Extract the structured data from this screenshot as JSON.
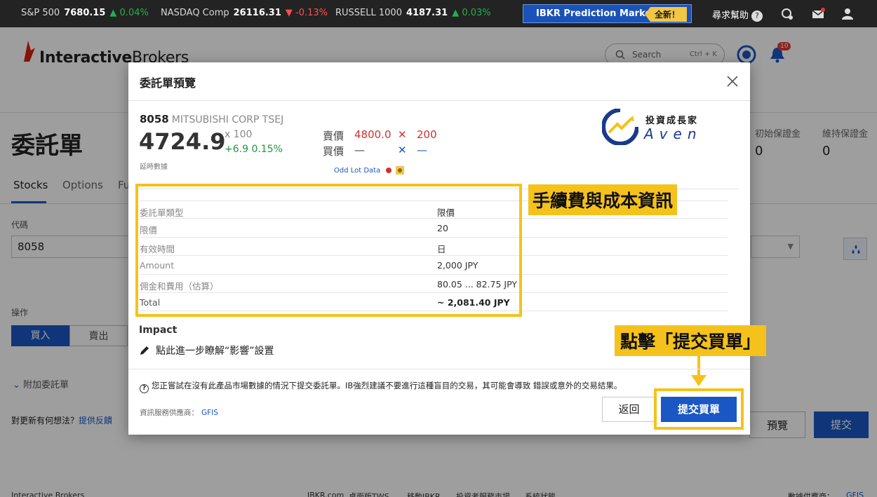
{
  "ticker": [
    {
      "name": "S&P 500",
      "price": "7680.15",
      "change": "▲ 0.04%",
      "dir": "up"
    },
    {
      "name": "NASDAQ Comp",
      "price": "26116.31",
      "change": "▼ -0.13%",
      "dir": "down"
    },
    {
      "name": "RUSSELL 1000",
      "price": "4187.31",
      "change": "▲ 0.03%",
      "dir": "up"
    }
  ],
  "promo": {
    "label": "IBKR Prediction Markets",
    "badge": "全新！"
  },
  "help": {
    "label": "尋求幫助",
    "q": "?"
  },
  "header": {
    "logo_bold": "Interactive",
    "logo_thin": "Brokers",
    "search_placeholder": "Search",
    "search_shortcut": "Ctrl + K",
    "notifications": "10"
  },
  "page": {
    "title": "委託單",
    "tabs": [
      "Stocks",
      "Options",
      "Fu"
    ],
    "symbol_label": "代碼",
    "symbol_value": "8058",
    "action_label": "操作",
    "buy": "買入",
    "sell": "賣出",
    "attach_order": "附加委託單",
    "feedback_q": "對更新有何想法？",
    "feedback_link": "提供反饋",
    "initial_margin_label": "初始保證金",
    "initial_margin_value": "0",
    "maint_margin_label": "維持保證金",
    "maint_margin_value": "0",
    "preview_btn": "預覽",
    "submit_btn": "提交"
  },
  "footer": {
    "company": "Interactive Brokers",
    "links": [
      "IBKR.com",
      "桌面版TWS",
      "移動IBKR",
      "投資者服務市場",
      "系統狀態"
    ],
    "data_provider": "數據供應商：",
    "gfis": "GFIS"
  },
  "modal": {
    "title": "委託單預覽",
    "quote": {
      "symbol": "8058",
      "name": "MITSUBISHI CORP TSEJ",
      "price": "4724.9",
      "multiplier": "x 100",
      "change": "+6.9 0.15%",
      "delayed": "延時數據",
      "ask_label": "賣價",
      "ask_price": "4800.0",
      "ask_size": "200",
      "bid_label": "買價",
      "bid_price": "—",
      "bid_size": "—",
      "odd_lot": "Odd Lot Data"
    },
    "brand": {
      "line1": "投資成長家",
      "line2": "Aven"
    },
    "order_rows": [
      {
        "k": "委託單類型",
        "v": "限價"
      },
      {
        "k": "限價",
        "v": "20"
      },
      {
        "k": "有效時間",
        "v": "日"
      },
      {
        "k": "Amount",
        "v": "2,000 JPY"
      },
      {
        "k": "佣金和費用（估算）",
        "v": "80.05 ... 82.75 JPY"
      },
      {
        "k": "Total",
        "v": "~ 2,081.40 JPY"
      }
    ],
    "annotation_fees": "手續費與成本資訊",
    "impact_title": "Impact",
    "impact_link": "點此進一步瞭解“影響”設置",
    "annotation_submit": "點擊「提交買單」",
    "warning": "您正嘗試在沒有此產品市場數據的情況下提交委託單。IB強烈建議不要進行這種盲目的交易，其可能會導致 錯誤或意外的交易結果。",
    "provider_label": "資訊服務供應商：",
    "provider_value": "GFIS",
    "back_btn": "返回",
    "submit_btn": "提交買單"
  },
  "colors": {
    "accent": "#1a57c4",
    "highlight": "#f5c21b",
    "ask": "#d32f2f",
    "gain": "#1a9a3a"
  }
}
